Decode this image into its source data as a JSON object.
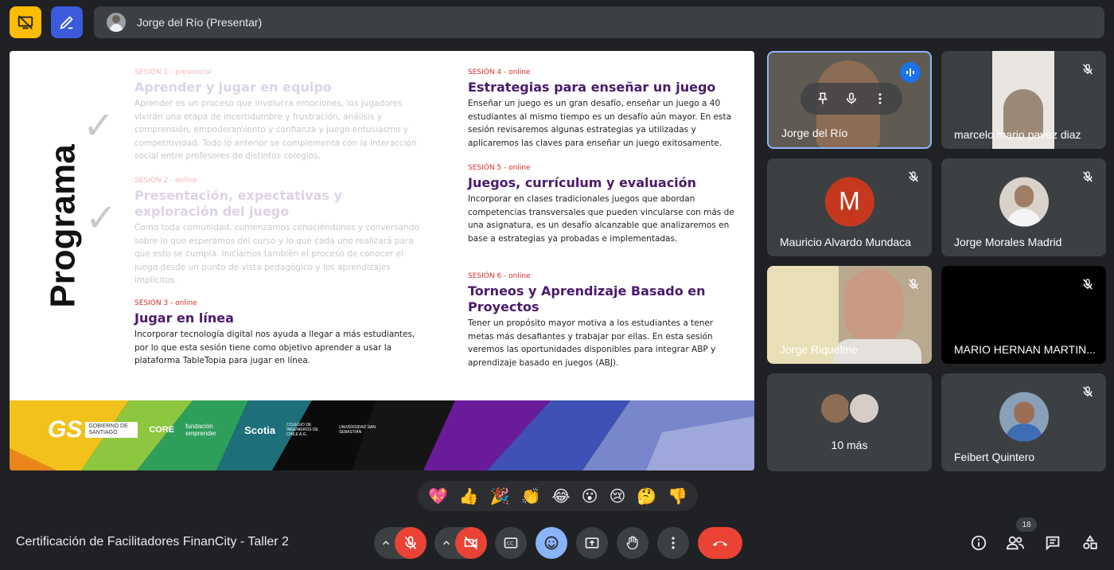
{
  "topbar": {
    "presenter_label": "Jorge del Río (Presentar)"
  },
  "slide": {
    "vertical_title": "Programa",
    "sessions": [
      {
        "tag": "SESIÓN 1 - presencial",
        "title": "Aprender y jugar en equipo",
        "desc": "Aprender es un proceso que involucra emociones, los jugadores vivirán una etapa de incertidumbre y frustración, análisis y comprensión, empoderamiento y confianza y juego entusiasmo y competitividad. Todo lo anterior se complementa con la interacción social entre profesores de distintos colegios."
      },
      {
        "tag": "SESIÓN 2 - online",
        "title": "Presentación, expectativas y exploración del juego",
        "desc": "Como toda comunidad, comenzamos conociéndonos y conversando sobre lo que esperamos del curso y lo que cada uno realizará para que esto se cumpla. Iniciamos también el proceso de conocer el juego desde un punto de vista pedagógico y los aprendizajes implícitos."
      },
      {
        "tag": "SESIÓN 3 - online",
        "title": "Jugar en línea",
        "desc": "Incorporar tecnología digital nos ayuda a llegar a más estudiantes, por lo que esta sesión tiene como objetivo aprender a usar la plataforma TableTopia para jugar en línea."
      },
      {
        "tag": "SESIÓN 4 - online",
        "title": "Estrategias para enseñar un juego",
        "desc": "Enseñar un juego es un gran desafío, enseñar un juego a 40 estudiantes al mismo tiempo es un desafío aún mayor. En esta sesión revisaremos algunas estrategias ya utilizadas y aplicaremos las claves para enseñar un juego exitosamente."
      },
      {
        "tag": "SESIÓN 5 - online",
        "title": "Juegos, currículum y evaluación",
        "desc": "Incorporar en clases tradicionales juegos que abordan competencias transversales que pueden vincularse con más de una asignatura, es un desafío alcanzable que analizaremos en base a estrategias ya probadas e implementadas."
      },
      {
        "tag": "SESIÓN 6 - online",
        "title": "Torneos y Aprendizaje Basado en Proyectos",
        "desc": "Tener un propósito mayor motiva a los estudiantes a tener metas más desafiantes y trabajar por ellas. En esta sesión veremos las oportunidades disponibles para integrar ABP y aprendizaje basado en juegos (ABJ)."
      }
    ],
    "logos": {
      "gs": "GS",
      "gs_sub": "GOBIERNO DE SANTIAGO",
      "core": "CORE",
      "fundacion": "fundación emprender",
      "scotia": "Scotia",
      "colegio": "COLEGIO DE INGENIEROS DE CHILE A.G.",
      "universidad": "UNIVERSIDAD SAN SEBASTIÁN"
    }
  },
  "participants": [
    {
      "name": "Jorge del Río",
      "initial": "",
      "color": "#5f5a52",
      "muted": false,
      "speaking": true
    },
    {
      "name": "marcelo mario pavez diaz",
      "initial": "",
      "color": "#e9e6e2",
      "muted": true
    },
    {
      "name": "Mauricio Alvardo Mundaca",
      "initial": "M",
      "color": "#c5381e",
      "muted": true
    },
    {
      "name": "Jorge Morales Madrid",
      "initial": "",
      "color": "#c8c2bb",
      "muted": true
    },
    {
      "name": "Jorge Riquelme",
      "initial": "",
      "color": "#b8a98f",
      "muted": true
    },
    {
      "name": "MARIO HERNAN MARTIN...",
      "initial": "",
      "color": "#000000",
      "muted": true
    },
    {
      "name": "10 más",
      "initial": "",
      "color": "#3c4043",
      "muted": false
    },
    {
      "name": "Feibert Quintero",
      "initial": "",
      "color": "#8aa0b8",
      "muted": true
    }
  ],
  "reactions": [
    "💖",
    "👍",
    "🎉",
    "👏",
    "😂",
    "😮",
    "😢",
    "🤔",
    "👎"
  ],
  "bottombar": {
    "meeting_title": "Certificación de Facilitadores FinanCity - Taller 2",
    "people_count": "18"
  },
  "colors": {
    "accent_red": "#ea4335",
    "accent_blue": "#8ab4f8",
    "session_title": "#4a1a6b"
  }
}
